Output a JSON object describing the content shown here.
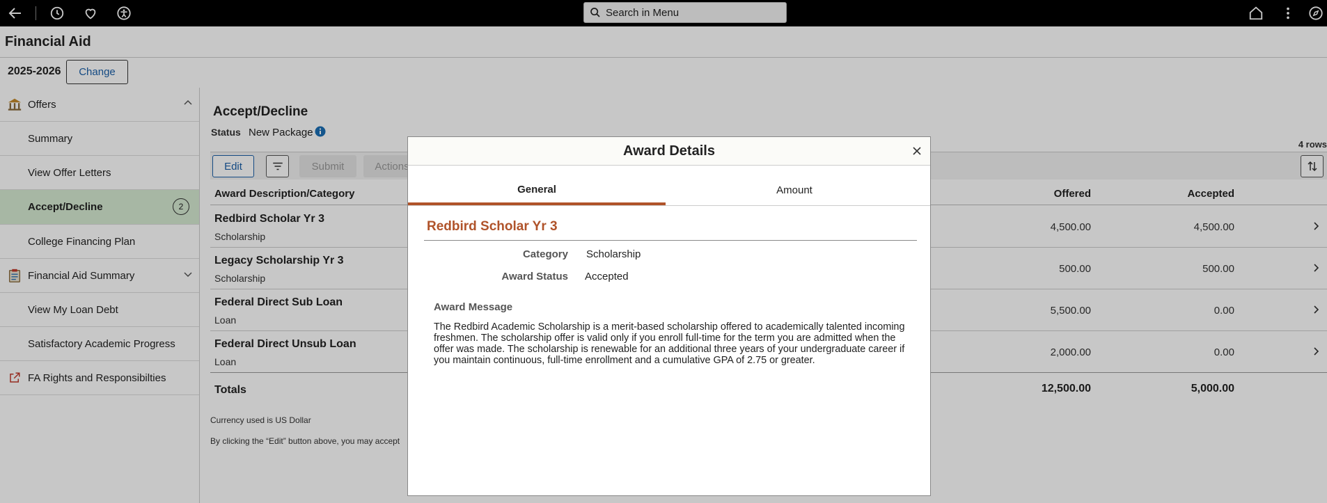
{
  "topbar": {
    "search_placeholder": "Search in Menu",
    "icons": [
      "back-arrow-icon",
      "clock-icon",
      "heart-icon",
      "accessibility-icon",
      "home-icon",
      "more-vertical-icon",
      "compass-icon"
    ]
  },
  "page": {
    "title": "Financial Aid"
  },
  "year": {
    "label": "2025-2026",
    "change_label": "Change"
  },
  "sidebar": {
    "items": [
      {
        "label": "Offers"
      },
      {
        "label": "Summary"
      },
      {
        "label": "View Offer Letters"
      },
      {
        "label": "Accept/Decline",
        "badge": "2"
      },
      {
        "label": "College Financing Plan"
      },
      {
        "label": "Financial Aid Summary"
      },
      {
        "label": "View My Loan Debt"
      },
      {
        "label": "Satisfactory Academic Progress"
      },
      {
        "label": "FA Rights and Responsibilties"
      }
    ]
  },
  "main": {
    "title": "Accept/Decline",
    "status_label": "Status",
    "status_value": "New Package",
    "row_count": "4 rows",
    "toolbar": {
      "edit": "Edit",
      "submit": "Submit",
      "actions": "Actions"
    },
    "columns": {
      "desc": "Award Description/Category",
      "offered": "Offered",
      "accepted": "Accepted"
    },
    "rows": [
      {
        "desc": "Redbird Scholar Yr 3",
        "cat": "Scholarship",
        "offered": "4,500.00",
        "accepted": "4,500.00"
      },
      {
        "desc": "Legacy Scholarship Yr 3",
        "cat": "Scholarship",
        "offered": "500.00",
        "accepted": "500.00"
      },
      {
        "desc": "Federal Direct Sub Loan",
        "cat": "Loan",
        "offered": "5,500.00",
        "accepted": "0.00"
      },
      {
        "desc": "Federal Direct Unsub Loan",
        "cat": "Loan",
        "offered": "2,000.00",
        "accepted": "0.00"
      }
    ],
    "totals": {
      "label": "Totals",
      "offered": "12,500.00",
      "accepted": "5,000.00"
    },
    "currency_note": "Currency used is US Dollar",
    "edit_note": "By clicking the “Edit” button above, you may accept"
  },
  "modal": {
    "title": "Award Details",
    "tabs": {
      "general": "General",
      "amount": "Amount"
    },
    "award_name": "Redbird Scholar Yr 3",
    "category_label": "Category",
    "category_value": "Scholarship",
    "status_label": "Award Status",
    "status_value": "Accepted",
    "message_label": "Award Message",
    "message_text": "The Redbird Academic Scholarship is a merit-based scholarship offered to academically talented incoming freshmen. The scholarship offer is valid only if you enroll full-time for the term you are admitted when the offer was made. The scholarship is renewable for an additional three years of your undergraduate career if you maintain continuous, full-time enrollment and a cumulative GPA of 2.75 or greater."
  },
  "colors": {
    "accent": "#b0532a",
    "selected_bg": "#d6ebd3",
    "link": "#1a5fa8"
  }
}
